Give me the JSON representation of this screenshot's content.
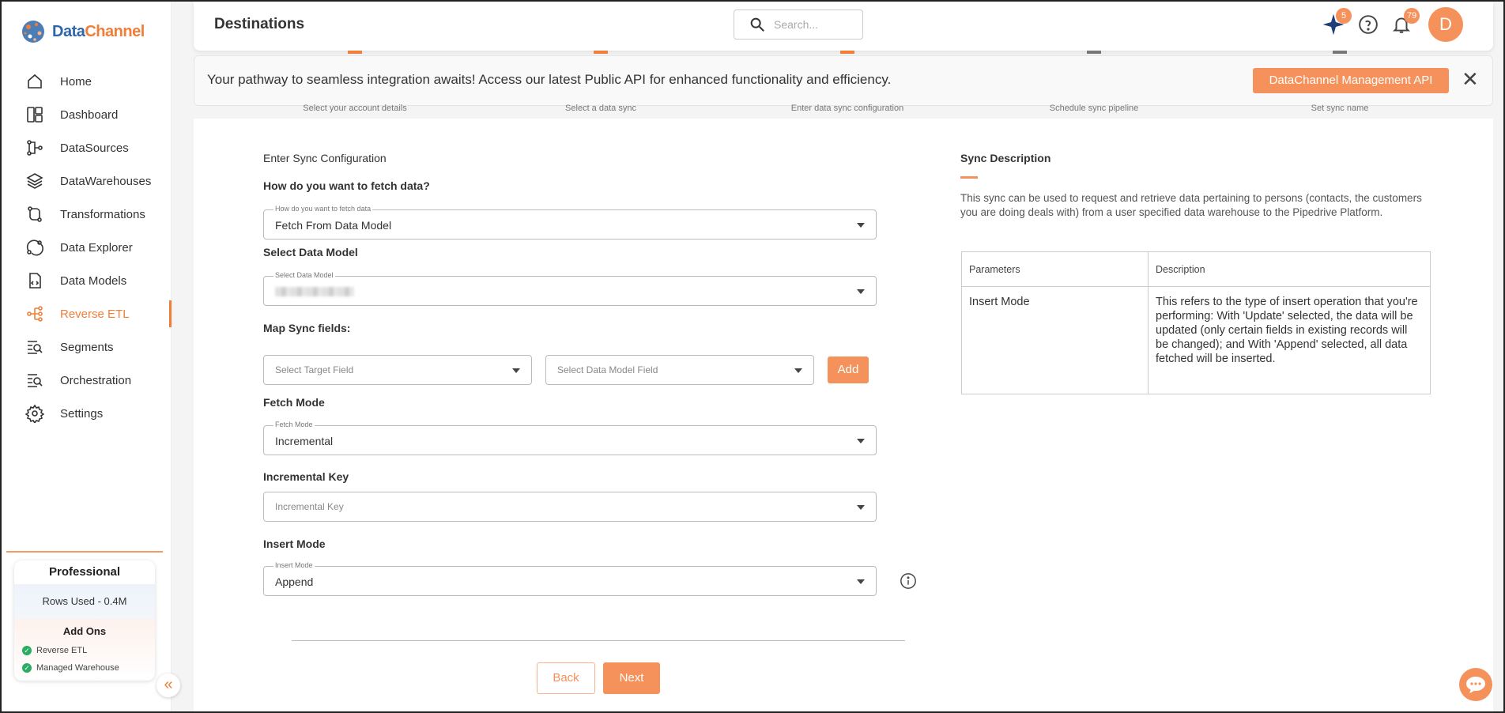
{
  "brand": {
    "name_part1": "Data",
    "name_part2": "Channel"
  },
  "nav": [
    {
      "label": "Home",
      "icon": "home-icon",
      "active": false
    },
    {
      "label": "Dashboard",
      "icon": "dashboard-icon",
      "active": false
    },
    {
      "label": "DataSources",
      "icon": "datasources-icon",
      "active": false
    },
    {
      "label": "DataWarehouses",
      "icon": "layers-icon",
      "active": false
    },
    {
      "label": "Transformations",
      "icon": "transform-icon",
      "active": false
    },
    {
      "label": "Data Explorer",
      "icon": "explorer-icon",
      "active": false
    },
    {
      "label": "Data Models",
      "icon": "model-icon",
      "active": false
    },
    {
      "label": "Reverse ETL",
      "icon": "reverse-etl-icon",
      "active": true
    },
    {
      "label": "Segments",
      "icon": "segments-icon",
      "active": false
    },
    {
      "label": "Orchestration",
      "icon": "orchestration-icon",
      "active": false
    },
    {
      "label": "Settings",
      "icon": "gear-icon",
      "active": false
    }
  ],
  "plan": {
    "name": "Professional",
    "rows_used": "Rows Used - 0.4M",
    "addons_title": "Add Ons",
    "addons": [
      "Reverse ETL",
      "Managed Warehouse"
    ]
  },
  "header": {
    "title": "Destinations",
    "search_placeholder": "Search...",
    "sparkle_badge": "5",
    "notif_badge": "79",
    "avatar_initial": "D"
  },
  "steps": [
    {
      "label": "Select your account details",
      "done": true
    },
    {
      "label": "Select a data sync",
      "done": true
    },
    {
      "label": "Enter data sync configuration",
      "done": true
    },
    {
      "label": "Schedule sync pipeline",
      "done": false
    },
    {
      "label": "Set sync name",
      "done": false
    }
  ],
  "banner": {
    "text": "Your pathway to seamless integration awaits! Access our latest Public API for enhanced functionality and efficiency.",
    "button": "DataChannel Management API"
  },
  "form": {
    "section_title": "Enter Sync Configuration",
    "fetch_label": "How do you want to fetch data?",
    "fetch_float": "How do you want to fetch data",
    "fetch_value": "Fetch From Data Model",
    "model_label": "Select Data Model",
    "model_float": "Select Data Model",
    "map_label": "Map Sync fields:",
    "target_placeholder": "Select Target Field",
    "model_field_placeholder": "Select Data Model Field",
    "add_button": "Add",
    "fetch_mode_label": "Fetch Mode",
    "fetch_mode_float": "Fetch Mode",
    "fetch_mode_value": "Incremental",
    "inc_key_label": "Incremental Key",
    "inc_key_placeholder": "Incremental Key",
    "insert_label": "Insert Mode",
    "insert_float": "Insert Mode",
    "insert_value": "Append",
    "back": "Back",
    "next": "Next"
  },
  "description": {
    "title": "Sync Description",
    "text": "This sync can be used to request and retrieve data pertaining to persons (contacts, the customers you are doing deals with) from a user specified data warehouse to the Pipedrive Platform.",
    "table_headers": [
      "Parameters",
      "Description"
    ],
    "rows": [
      [
        "Insert Mode",
        "This refers to the type of insert operation that you're performing: With 'Update' selected, the data will be updated (only certain fields in existing records will be changed); and With 'Append' selected, all data fetched will be inserted."
      ]
    ]
  },
  "colors": {
    "accent": "#f5915a",
    "brand_blue": "#2e66a8"
  }
}
